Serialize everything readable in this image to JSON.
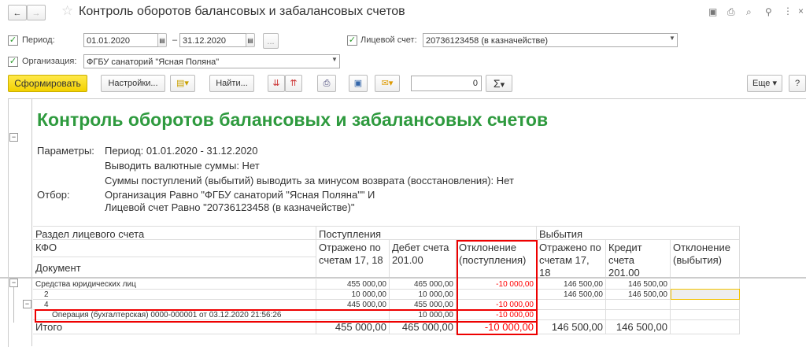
{
  "window": {
    "title": "Контроль оборотов балансовых и забалансовых счетов"
  },
  "filters": {
    "period_label": "Период:",
    "period_from": "01.01.2020",
    "period_dash": "–",
    "period_to": "31.12.2020",
    "period_more": "...",
    "account_label": "Лицевой счет:",
    "account_value": "20736123458 (в казначействе)",
    "org_label": "Организация:",
    "org_value": "ФГБУ санаторий \"Ясная Поляна\""
  },
  "toolbar": {
    "generate": "Сформировать",
    "settings": "Настройки...",
    "find": "Найти...",
    "counter": "0",
    "sigma": "Σ",
    "more": "Еще",
    "help": "?"
  },
  "report": {
    "title": "Контроль оборотов балансовых и забалансовых счетов",
    "params_label": "Параметры:",
    "params": [
      "Период: 01.01.2020 - 31.12.2020",
      "Выводить валютные суммы: Нет",
      "Суммы поступлений (выбытий) выводить за минусом возврата (восстановления): Нет"
    ],
    "filter_label": "Отбор:",
    "filter": [
      "Организация Равно \"ФГБУ санаторий \"Ясная Поляна\"\" И",
      "Лицевой счет Равно \"20736123458 (в казначействе)\""
    ],
    "headers": {
      "section": "Раздел лицевого счета",
      "kfo": "КФО",
      "document": "Документ",
      "income": "Поступления",
      "outcome": "Выбытия",
      "cols": [
        "Отражено по счетам 17, 18",
        "Дебет счета 201.00",
        "Отклонение (поступления)",
        "Отражено по счетам 17, 18",
        "Кредит счета 201.00",
        "Отклонение (выбытия)"
      ]
    },
    "rows": [
      {
        "name": "Средства юридических лиц",
        "v": [
          "455 000,00",
          "465 000,00",
          "-10 000,00",
          "146 500,00",
          "146 500,00",
          ""
        ]
      },
      {
        "name": "2",
        "v": [
          "10 000,00",
          "10 000,00",
          "",
          "146 500,00",
          "146 500,00",
          ""
        ]
      },
      {
        "name": "4",
        "v": [
          "445 000,00",
          "455 000,00",
          "-10 000,00",
          "",
          "",
          ""
        ]
      },
      {
        "name": "Операция (бухгалтерская) 0000-000001 от 03.12.2020 21:56:26",
        "v": [
          "",
          "10 000,00",
          "-10 000,00",
          "",
          "",
          ""
        ]
      }
    ],
    "total": {
      "name": "Итого",
      "v": [
        "455 000,00",
        "465 000,00",
        "-10 000,00",
        "146 500,00",
        "146 500,00",
        ""
      ]
    }
  }
}
